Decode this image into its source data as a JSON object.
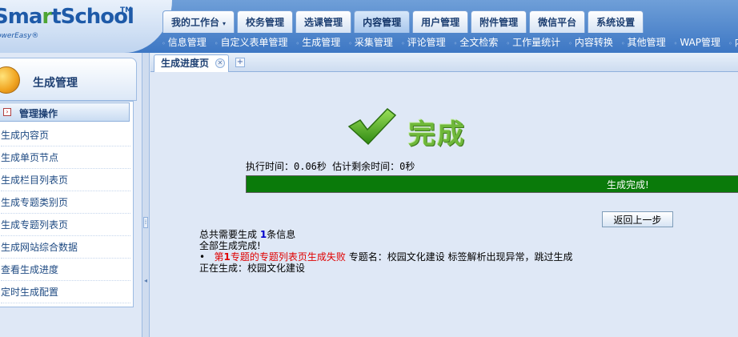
{
  "app": {
    "logo_prefix": "Sma",
    "logo_leaf": "r",
    "logo_suffix": "tSchool",
    "logo_tm": "TM",
    "logo_sub": "owerEasy®"
  },
  "main_nav": [
    {
      "label": "我的工作台",
      "active": false,
      "caret": "▾"
    },
    {
      "label": "校务管理",
      "active": false
    },
    {
      "label": "选课管理",
      "active": false
    },
    {
      "label": "内容管理",
      "active": true
    },
    {
      "label": "用户管理",
      "active": false
    },
    {
      "label": "附件管理",
      "active": false
    },
    {
      "label": "微信平台",
      "active": false
    },
    {
      "label": "系统设置",
      "active": false
    }
  ],
  "sub_nav": [
    "信息管理",
    "自定义表单管理",
    "生成管理",
    "采集管理",
    "评论管理",
    "全文检索",
    "工作量统计",
    "内容转换",
    "其他管理",
    "WAP管理",
    "内容"
  ],
  "sidebar": {
    "title": "生成管理",
    "section": "管理操作",
    "items": [
      "生成内容页",
      "生成单页节点",
      "生成栏目列表页",
      "生成专题类别页",
      "生成专题列表页",
      "生成网站综合数据",
      "查看生成进度",
      "定时生成配置"
    ]
  },
  "tab": {
    "label": "生成进度页"
  },
  "status": {
    "title": "完成",
    "timing": "执行时间：0.06秒 估计剩余时间：0秒",
    "progress_label": "生成完成!",
    "progress_percent": 100,
    "back_button": "返回上一步"
  },
  "log": {
    "line1_prefix": "总共需要生成 ",
    "line1_count": "1",
    "line1_suffix": "条信息",
    "line2": "全部生成完成!",
    "line3_bullet": "•",
    "line3_err_prefix": "第",
    "line3_err_count": "1",
    "line3_err_suffix": "专题的专题列表页生成失败",
    "line3_rest": "  专题名：校园文化建设  标签解析出现异常，跳过生成",
    "line4": "正在生成：校园文化建设"
  },
  "colors": {
    "progress_fill": "#0a7a0a",
    "error_text": "#e00000",
    "count_text": "#0000cc",
    "done_text": "#6fb83a"
  }
}
